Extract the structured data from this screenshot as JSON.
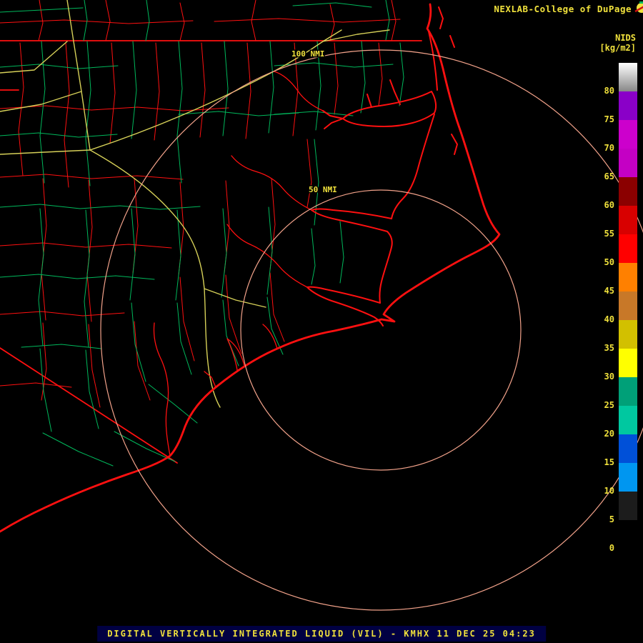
{
  "header": {
    "brand": "NEXLAB-College of DuPage",
    "product": "NIDS",
    "units": "[kg/m2]"
  },
  "map": {
    "rings": [
      {
        "label": "100 NMI"
      },
      {
        "label": "50 NMI"
      }
    ]
  },
  "scale": {
    "top_gradient": [
      "#ffffff",
      "#878787"
    ],
    "segments": [
      {
        "range": "gt80",
        "color": "gradient"
      },
      {
        "range": "75-80",
        "color": "#8a00c8"
      },
      {
        "range": "70-75",
        "color": "#cc00cc"
      },
      {
        "range": "65-70",
        "color": "#c400c4"
      },
      {
        "range": "60-65",
        "color": "#8b0000"
      },
      {
        "range": "55-60",
        "color": "#d80000"
      },
      {
        "range": "50-55",
        "color": "#ff0000"
      },
      {
        "range": "45-50",
        "color": "#ff8000"
      },
      {
        "range": "40-45",
        "color": "#c87828"
      },
      {
        "range": "35-40",
        "color": "#d2c000"
      },
      {
        "range": "30-35",
        "color": "#ffff00"
      },
      {
        "range": "25-30",
        "color": "#00a078"
      },
      {
        "range": "20-25",
        "color": "#00c8a0"
      },
      {
        "range": "15-20",
        "color": "#0050d8"
      },
      {
        "range": "10-15",
        "color": "#0096f0"
      },
      {
        "range": "5-10",
        "color": "#1c1c1c"
      },
      {
        "range": "0-5",
        "color": "#000000"
      }
    ],
    "labels": [
      "80",
      "75",
      "70",
      "65",
      "60",
      "55",
      "50",
      "45",
      "40",
      "35",
      "30",
      "25",
      "20",
      "15",
      "10",
      "5",
      "0"
    ]
  },
  "footer": {
    "title": "DIGITAL VERTICALLY INTEGRATED LIQUID (VIL) - KMHX 11 DEC 25 04:23"
  },
  "colors": {
    "background": "#000000",
    "text": "#f0e13c",
    "ring": "#f2a28a",
    "map_red": "#ff1010",
    "map_green": "#00b85c",
    "map_yellow": "#d6d058",
    "footer_bg": "#000042"
  }
}
